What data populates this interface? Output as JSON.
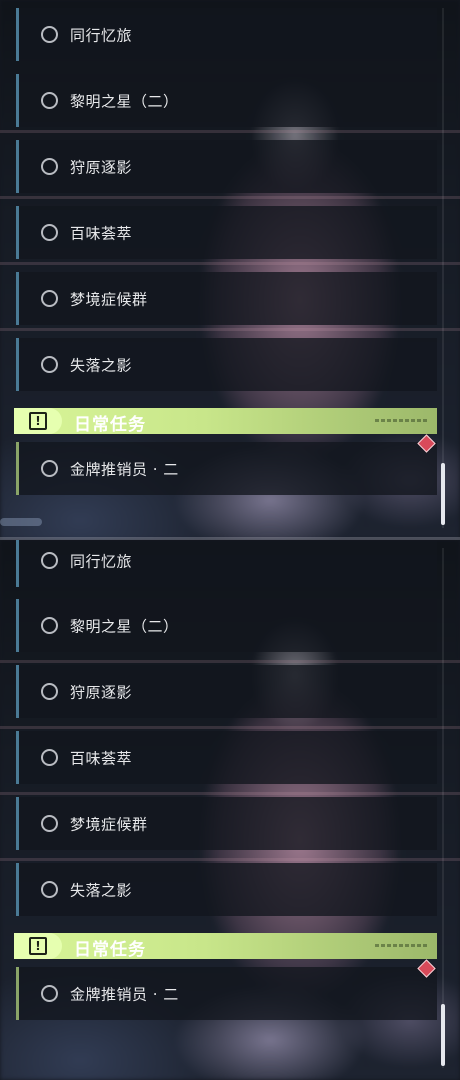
{
  "panels": [
    {
      "quests": [
        {
          "label": "同行忆旅"
        },
        {
          "label": "黎明之星（二）"
        },
        {
          "label": "狩原逐影"
        },
        {
          "label": "百味荟萃"
        },
        {
          "label": "梦境症候群"
        },
        {
          "label": "失落之影"
        }
      ],
      "daily_header": {
        "title": "日常任务",
        "icon": "exclamation-icon"
      },
      "daily_quests": [
        {
          "label": "金牌推销员 · 二"
        }
      ]
    },
    {
      "quests": [
        {
          "label": "同行忆旅"
        },
        {
          "label": "黎明之星（二）"
        },
        {
          "label": "狩原逐影"
        },
        {
          "label": "百味荟萃"
        },
        {
          "label": "梦境症候群"
        },
        {
          "label": "失落之影"
        }
      ],
      "daily_header": {
        "title": "日常任务",
        "icon": "exclamation-icon"
      },
      "daily_quests": [
        {
          "label": "金牌推销员 · 二"
        }
      ]
    }
  ],
  "colors": {
    "story_accent": "#4a7a95",
    "daily_accent": "#8aa468",
    "header_green": "#d8f598",
    "marker_red": "#d84a5a"
  }
}
